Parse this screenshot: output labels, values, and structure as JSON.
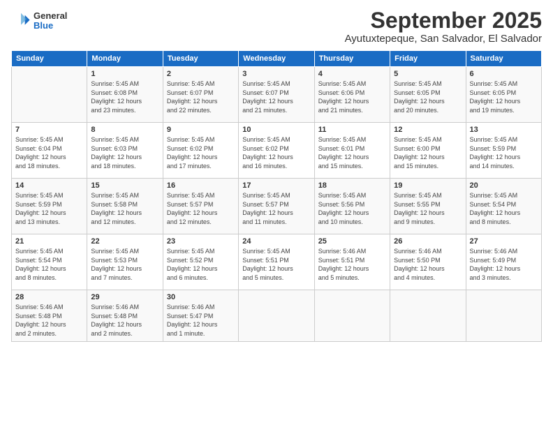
{
  "logo": {
    "general": "General",
    "blue": "Blue"
  },
  "title": "September 2025",
  "subtitle": "Ayutuxtepeque, San Salvador, El Salvador",
  "weekdays": [
    "Sunday",
    "Monday",
    "Tuesday",
    "Wednesday",
    "Thursday",
    "Friday",
    "Saturday"
  ],
  "weeks": [
    [
      {
        "day": "",
        "info": ""
      },
      {
        "day": "1",
        "info": "Sunrise: 5:45 AM\nSunset: 6:08 PM\nDaylight: 12 hours\nand 23 minutes."
      },
      {
        "day": "2",
        "info": "Sunrise: 5:45 AM\nSunset: 6:07 PM\nDaylight: 12 hours\nand 22 minutes."
      },
      {
        "day": "3",
        "info": "Sunrise: 5:45 AM\nSunset: 6:07 PM\nDaylight: 12 hours\nand 21 minutes."
      },
      {
        "day": "4",
        "info": "Sunrise: 5:45 AM\nSunset: 6:06 PM\nDaylight: 12 hours\nand 21 minutes."
      },
      {
        "day": "5",
        "info": "Sunrise: 5:45 AM\nSunset: 6:05 PM\nDaylight: 12 hours\nand 20 minutes."
      },
      {
        "day": "6",
        "info": "Sunrise: 5:45 AM\nSunset: 6:05 PM\nDaylight: 12 hours\nand 19 minutes."
      }
    ],
    [
      {
        "day": "7",
        "info": "Sunrise: 5:45 AM\nSunset: 6:04 PM\nDaylight: 12 hours\nand 18 minutes."
      },
      {
        "day": "8",
        "info": "Sunrise: 5:45 AM\nSunset: 6:03 PM\nDaylight: 12 hours\nand 18 minutes."
      },
      {
        "day": "9",
        "info": "Sunrise: 5:45 AM\nSunset: 6:02 PM\nDaylight: 12 hours\nand 17 minutes."
      },
      {
        "day": "10",
        "info": "Sunrise: 5:45 AM\nSunset: 6:02 PM\nDaylight: 12 hours\nand 16 minutes."
      },
      {
        "day": "11",
        "info": "Sunrise: 5:45 AM\nSunset: 6:01 PM\nDaylight: 12 hours\nand 15 minutes."
      },
      {
        "day": "12",
        "info": "Sunrise: 5:45 AM\nSunset: 6:00 PM\nDaylight: 12 hours\nand 15 minutes."
      },
      {
        "day": "13",
        "info": "Sunrise: 5:45 AM\nSunset: 5:59 PM\nDaylight: 12 hours\nand 14 minutes."
      }
    ],
    [
      {
        "day": "14",
        "info": "Sunrise: 5:45 AM\nSunset: 5:59 PM\nDaylight: 12 hours\nand 13 minutes."
      },
      {
        "day": "15",
        "info": "Sunrise: 5:45 AM\nSunset: 5:58 PM\nDaylight: 12 hours\nand 12 minutes."
      },
      {
        "day": "16",
        "info": "Sunrise: 5:45 AM\nSunset: 5:57 PM\nDaylight: 12 hours\nand 12 minutes."
      },
      {
        "day": "17",
        "info": "Sunrise: 5:45 AM\nSunset: 5:57 PM\nDaylight: 12 hours\nand 11 minutes."
      },
      {
        "day": "18",
        "info": "Sunrise: 5:45 AM\nSunset: 5:56 PM\nDaylight: 12 hours\nand 10 minutes."
      },
      {
        "day": "19",
        "info": "Sunrise: 5:45 AM\nSunset: 5:55 PM\nDaylight: 12 hours\nand 9 minutes."
      },
      {
        "day": "20",
        "info": "Sunrise: 5:45 AM\nSunset: 5:54 PM\nDaylight: 12 hours\nand 8 minutes."
      }
    ],
    [
      {
        "day": "21",
        "info": "Sunrise: 5:45 AM\nSunset: 5:54 PM\nDaylight: 12 hours\nand 8 minutes."
      },
      {
        "day": "22",
        "info": "Sunrise: 5:45 AM\nSunset: 5:53 PM\nDaylight: 12 hours\nand 7 minutes."
      },
      {
        "day": "23",
        "info": "Sunrise: 5:45 AM\nSunset: 5:52 PM\nDaylight: 12 hours\nand 6 minutes."
      },
      {
        "day": "24",
        "info": "Sunrise: 5:45 AM\nSunset: 5:51 PM\nDaylight: 12 hours\nand 5 minutes."
      },
      {
        "day": "25",
        "info": "Sunrise: 5:46 AM\nSunset: 5:51 PM\nDaylight: 12 hours\nand 5 minutes."
      },
      {
        "day": "26",
        "info": "Sunrise: 5:46 AM\nSunset: 5:50 PM\nDaylight: 12 hours\nand 4 minutes."
      },
      {
        "day": "27",
        "info": "Sunrise: 5:46 AM\nSunset: 5:49 PM\nDaylight: 12 hours\nand 3 minutes."
      }
    ],
    [
      {
        "day": "28",
        "info": "Sunrise: 5:46 AM\nSunset: 5:48 PM\nDaylight: 12 hours\nand 2 minutes."
      },
      {
        "day": "29",
        "info": "Sunrise: 5:46 AM\nSunset: 5:48 PM\nDaylight: 12 hours\nand 2 minutes."
      },
      {
        "day": "30",
        "info": "Sunrise: 5:46 AM\nSunset: 5:47 PM\nDaylight: 12 hours\nand 1 minute."
      },
      {
        "day": "",
        "info": ""
      },
      {
        "day": "",
        "info": ""
      },
      {
        "day": "",
        "info": ""
      },
      {
        "day": "",
        "info": ""
      }
    ]
  ]
}
